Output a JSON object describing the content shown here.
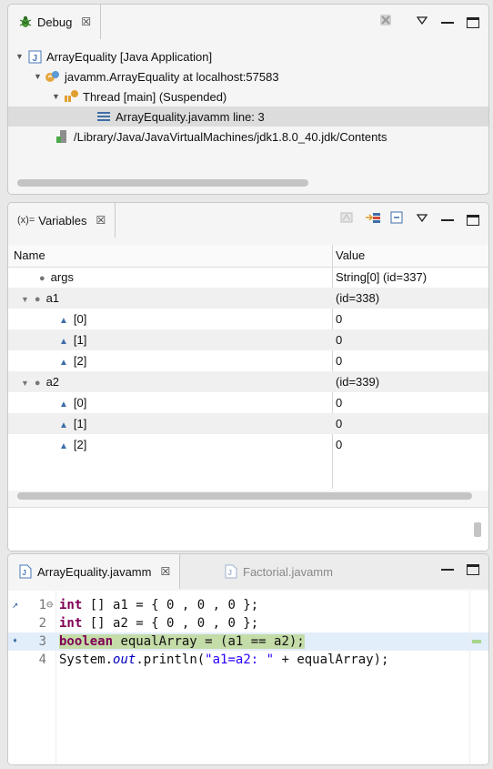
{
  "debug": {
    "tab_label": "Debug",
    "close_glyph": "☒",
    "tree": {
      "app": "ArrayEquality [Java Application]",
      "target": "javamm.ArrayEquality at localhost:57583",
      "thread": "Thread [main] (Suspended)",
      "frame": "ArrayEquality.javamm line: 3",
      "jvm": "/Library/Java/JavaVirtualMachines/jdk1.8.0_40.jdk/Contents"
    }
  },
  "variables": {
    "tab_label": "Variables",
    "tab_prefix": "(x)=",
    "close_glyph": "☒",
    "headers": {
      "name": "Name",
      "value": "Value"
    },
    "rows": [
      {
        "name": "args",
        "value": "String[0]  (id=337)"
      },
      {
        "name": "a1",
        "value": "(id=338)"
      },
      {
        "name": "[0]",
        "value": "0"
      },
      {
        "name": "[1]",
        "value": "0"
      },
      {
        "name": "[2]",
        "value": "0"
      },
      {
        "name": "a2",
        "value": "(id=339)"
      },
      {
        "name": "[0]",
        "value": "0"
      },
      {
        "name": "[1]",
        "value": "0"
      },
      {
        "name": "[2]",
        "value": "0"
      }
    ]
  },
  "editor": {
    "tabs": [
      {
        "label": "ArrayEquality.javamm",
        "close_glyph": "☒"
      },
      {
        "label": "Factorial.javamm"
      }
    ],
    "lines": [
      {
        "no": "1",
        "marker": "⊖"
      },
      {
        "no": "2"
      },
      {
        "no": "3"
      },
      {
        "no": "4"
      }
    ],
    "code": {
      "l1_kw": "int",
      "l1_rest": " [] a1 = { 0 , 0 , 0 };",
      "l2_kw": "int",
      "l2_rest": " [] a2 = { 0 , 0 , 0 };",
      "l3_kw": "boolean",
      "l3_rest": " equalArray = (a1 == a2);",
      "l4_a": "System.",
      "l4_it": "out",
      "l4_b": ".println(",
      "l4_str": "\"a1=a2: \"",
      "l4_c": " + equalArray);"
    }
  },
  "colors": {
    "keyword": "#7f0055",
    "string": "#2a00ff",
    "current_line": "#e3eefb",
    "highlight": "#c4dca8"
  }
}
